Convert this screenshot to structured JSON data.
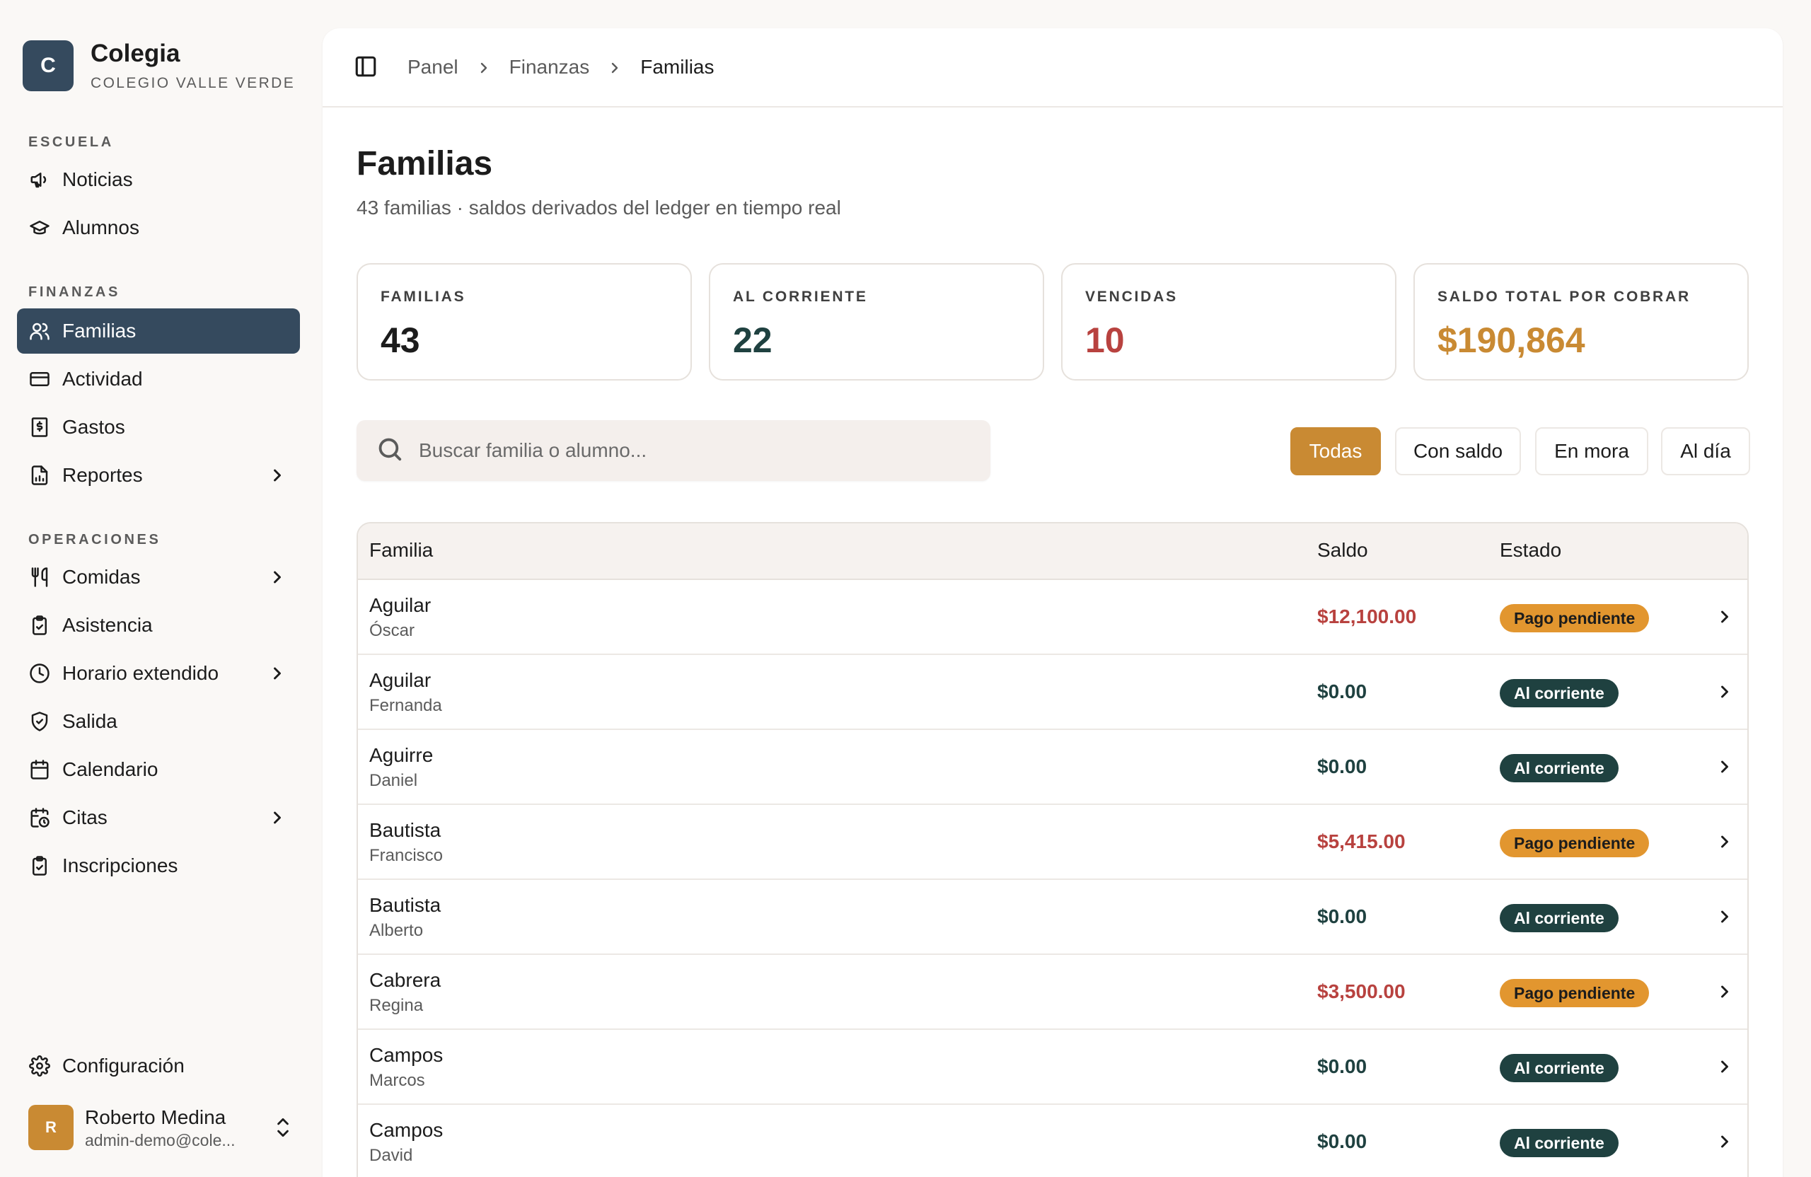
{
  "brand": {
    "logo_letter": "C",
    "name": "Colegia",
    "school": "COLEGIO VALLE VERDE"
  },
  "sidebar": {
    "sections": [
      {
        "title": "ESCUELA",
        "items": [
          {
            "label": "Noticias",
            "icon": "megaphone-icon"
          },
          {
            "label": "Alumnos",
            "icon": "graduation-cap-icon"
          }
        ]
      },
      {
        "title": "FINANZAS",
        "items": [
          {
            "label": "Familias",
            "icon": "users-icon",
            "active": true
          },
          {
            "label": "Actividad",
            "icon": "credit-card-icon"
          },
          {
            "label": "Gastos",
            "icon": "receipt-icon"
          },
          {
            "label": "Reportes",
            "icon": "report-icon",
            "expandable": true
          }
        ]
      },
      {
        "title": "OPERACIONES",
        "items": [
          {
            "label": "Comidas",
            "icon": "utensils-icon",
            "expandable": true
          },
          {
            "label": "Asistencia",
            "icon": "clipboard-check-icon"
          },
          {
            "label": "Horario extendido",
            "icon": "clock-icon",
            "expandable": true
          },
          {
            "label": "Salida",
            "icon": "shield-check-icon"
          },
          {
            "label": "Calendario",
            "icon": "calendar-icon"
          },
          {
            "label": "Citas",
            "icon": "calendar-clock-icon",
            "expandable": true
          },
          {
            "label": "Inscripciones",
            "icon": "clipboard-list-icon"
          }
        ]
      }
    ],
    "settings_label": "Configuración",
    "user": {
      "initial": "R",
      "name": "Roberto Medina",
      "email": "admin-demo@cole..."
    }
  },
  "breadcrumb": [
    "Panel",
    "Finanzas",
    "Familias"
  ],
  "page": {
    "title": "Familias",
    "subtitle": "43 familias · saldos derivados del ledger en tiempo real"
  },
  "stats": [
    {
      "label": "FAMILIAS",
      "value": "43",
      "color": "#1c1c1c"
    },
    {
      "label": "AL CORRIENTE",
      "value": "22",
      "color": "#1f4140"
    },
    {
      "label": "VENCIDAS",
      "value": "10",
      "color": "#b8423f"
    },
    {
      "label": "SALDO TOTAL POR COBRAR",
      "value": "$190,864",
      "color": "#c98a33"
    }
  ],
  "search": {
    "placeholder": "Buscar familia o alumno..."
  },
  "filters": [
    {
      "label": "Todas",
      "active": true
    },
    {
      "label": "Con saldo"
    },
    {
      "label": "En mora"
    },
    {
      "label": "Al día"
    }
  ],
  "table": {
    "headers": {
      "family": "Familia",
      "balance": "Saldo",
      "status": "Estado"
    },
    "rows": [
      {
        "family": "Aguilar",
        "student": "Óscar",
        "balance": "$12,100.00",
        "status": "Pago pendiente",
        "kind": "pending"
      },
      {
        "family": "Aguilar",
        "student": "Fernanda",
        "balance": "$0.00",
        "status": "Al corriente",
        "kind": "ok"
      },
      {
        "family": "Aguirre",
        "student": "Daniel",
        "balance": "$0.00",
        "status": "Al corriente",
        "kind": "ok"
      },
      {
        "family": "Bautista",
        "student": "Francisco",
        "balance": "$5,415.00",
        "status": "Pago pendiente",
        "kind": "pending"
      },
      {
        "family": "Bautista",
        "student": "Alberto",
        "balance": "$0.00",
        "status": "Al corriente",
        "kind": "ok"
      },
      {
        "family": "Cabrera",
        "student": "Regina",
        "balance": "$3,500.00",
        "status": "Pago pendiente",
        "kind": "pending"
      },
      {
        "family": "Campos",
        "student": "Marcos",
        "balance": "$0.00",
        "status": "Al corriente",
        "kind": "ok"
      },
      {
        "family": "Campos",
        "student": "David",
        "balance": "$0.00",
        "status": "Al corriente",
        "kind": "ok"
      }
    ]
  },
  "colors": {
    "balance_due": "#b8423f",
    "balance_zero": "#1f4140",
    "accent": "#c98a33",
    "active_nav": "#354a5e"
  }
}
